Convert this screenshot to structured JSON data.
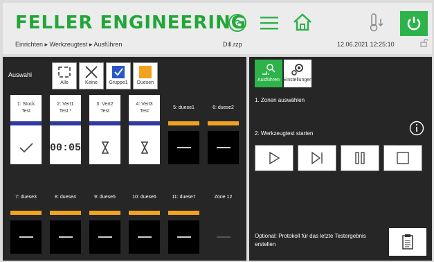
{
  "header": {
    "brand": "FELLER ENGINEERING",
    "breadcrumb": "Einrichten ▸ Werkzeugtest ▸ Ausführen",
    "file": "Dill.rzp",
    "datetime": "12.06.2021 12:25:10",
    "icons": [
      "help-icon",
      "menu-icon",
      "home-icon",
      "temperature-down-icon",
      "power-icon",
      "lock-icon"
    ],
    "accent_color": "#2db34a"
  },
  "selection": {
    "label": "Auswahl",
    "buttons": [
      {
        "label": "Alle",
        "icon": "select-all-icon"
      },
      {
        "label": "Keine",
        "icon": "close-icon"
      },
      {
        "label": "Gruppe1",
        "icon": "checkbox-checked-icon"
      },
      {
        "label": "Duesen",
        "icon": "orange-square-icon"
      }
    ]
  },
  "zones_row1": [
    {
      "label1": "1: Stock",
      "label2": "Test",
      "status": "check-icon",
      "style": "white",
      "stripe": "#2e3aa0"
    },
    {
      "label1": "2: Vert1",
      "label2": "Test *",
      "status": "00:05",
      "style": "white",
      "stripe": "#2e3aa0"
    },
    {
      "label1": "3: Vert2",
      "label2": "Test",
      "status": "hourglass-icon",
      "style": "white",
      "stripe": "#2e3aa0"
    },
    {
      "label1": "4: Vert3",
      "label2": "Test",
      "status": "hourglass-icon",
      "style": "white",
      "stripe": "#2e3aa0"
    },
    {
      "label1": "5: duese1",
      "label2": "",
      "status": "dash",
      "style": "dark",
      "stripe": "#f3a21f"
    },
    {
      "label1": "6: duese2",
      "label2": "",
      "status": "dash",
      "style": "dark",
      "stripe": "#f3a21f"
    }
  ],
  "zones_row2": [
    {
      "label1": "7: duese3",
      "status": "dash",
      "stripe": "#f3a21f"
    },
    {
      "label1": "8: duese4",
      "status": "dash",
      "stripe": "#f3a21f"
    },
    {
      "label1": "9: duese5",
      "status": "dash",
      "stripe": "#f3a21f"
    },
    {
      "label1": "10: duese6",
      "status": "dash",
      "stripe": "#f3a21f"
    },
    {
      "label1": "11: duese7",
      "status": "dash",
      "stripe": "#f3a21f"
    },
    {
      "label1": "Zone 12",
      "status": "dash",
      "stripe": "none"
    }
  ],
  "right_panel": {
    "tab_run": "Ausführen",
    "tab_settings": "Einstellungen",
    "step1": "1. Zonen auswählen",
    "step2": "2. Werkzeugtest starten",
    "controls": [
      "play-icon",
      "step-forward-icon",
      "pause-icon",
      "stop-icon"
    ],
    "optional": "Optional: Protokoll für das letzte Testergebnis erstellen"
  }
}
